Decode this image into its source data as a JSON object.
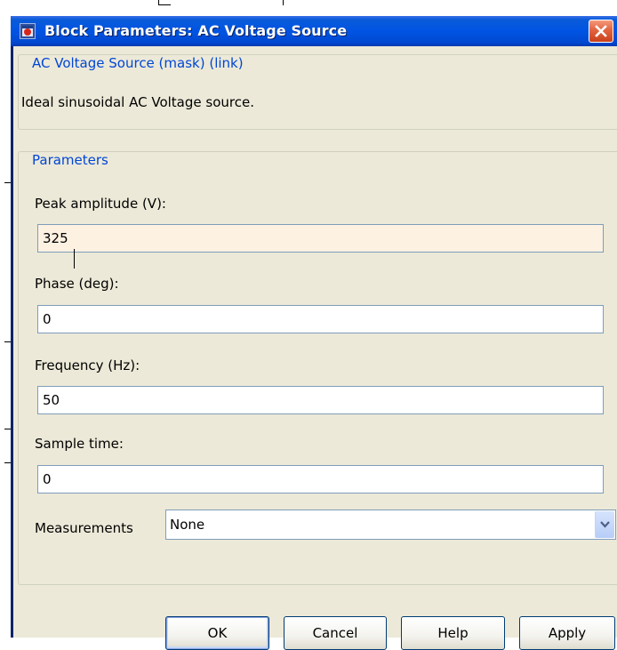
{
  "window": {
    "title": "Block Parameters: AC Voltage Source",
    "title_icon": "simulink-block-icon",
    "close_icon": "close-icon"
  },
  "description_group": {
    "legend": "AC Voltage Source (mask) (link)",
    "text": "Ideal sinusoidal AC Voltage source."
  },
  "parameters_group": {
    "legend": "Parameters",
    "fields": [
      {
        "label": "Peak amplitude (V):",
        "value": "325"
      },
      {
        "label": "Phase (deg):",
        "value": "0"
      },
      {
        "label": "Frequency (Hz):",
        "value": "50"
      },
      {
        "label": "Sample time:",
        "value": "0"
      }
    ],
    "measurements": {
      "label": "Measurements",
      "selected": "None",
      "arrow_icon": "chevron-down-icon"
    }
  },
  "buttons": {
    "ok": "OK",
    "cancel": "Cancel",
    "help": "Help",
    "apply": "Apply"
  },
  "colors": {
    "titlebar": "#0054e3",
    "dialog_background": "#ece9d8",
    "legend_text": "#0046d5",
    "focused_field": "#fdf1e2",
    "close_button": "#e2643e"
  }
}
